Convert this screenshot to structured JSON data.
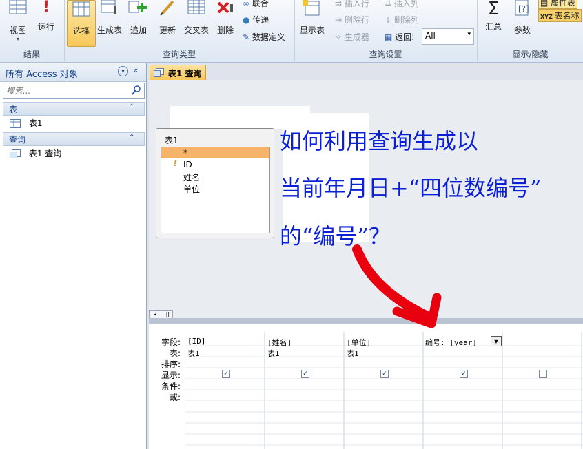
{
  "ribbon": {
    "buttons": {
      "view": "视图",
      "run": "运行",
      "select": "选择",
      "make_table": "生成表",
      "append": "追加",
      "update": "更新",
      "crosstab": "交叉表",
      "delete": "删除",
      "show_table": "显示表",
      "totals": "汇总",
      "parameters": "参数"
    },
    "small": {
      "union": "联合",
      "pass_through": "传递",
      "data_definition": "数据定义",
      "insert_rows": "插入行",
      "delete_rows": "删除行",
      "builder": "生成器",
      "insert_columns": "插入列",
      "delete_columns": "删除列",
      "return_label": "返回:",
      "return_value": "All",
      "property_sheet": "属性表",
      "table_names": "表名称"
    },
    "groups": {
      "results": "结果",
      "query_type": "查询类型",
      "query_setup": "查询设置",
      "show_hide": "显示/隐藏"
    }
  },
  "nav": {
    "title": "所有 Access 对象",
    "search_placeholder": "搜索...",
    "sections": [
      {
        "label": "表",
        "items": [
          "表1"
        ]
      },
      {
        "label": "查询",
        "items": [
          "表1 查询"
        ]
      }
    ]
  },
  "doc_tab": "表1 查询",
  "table_box": {
    "title": "表1",
    "fields": [
      "*",
      "ID",
      "姓名",
      "单位"
    ]
  },
  "annotation": {
    "line1": "如何利用查询生成以",
    "line2": "当前年月日+“四位数编号”",
    "line3": "的“编号”？"
  },
  "grid": {
    "row_labels": [
      "字段:",
      "表:",
      "排序:",
      "显示:",
      "条件:",
      "或:"
    ],
    "columns": [
      {
        "field": "[ID]",
        "table": "表1",
        "show": true
      },
      {
        "field": "[姓名]",
        "table": "表1",
        "show": true
      },
      {
        "field": "[单位]",
        "table": "表1",
        "show": true
      },
      {
        "field": "编号: [year]",
        "table": "",
        "show": true
      },
      {
        "field": "",
        "table": "",
        "show": false
      }
    ]
  },
  "colors": {
    "accent": "#f8c85a",
    "arrow": "#e8000e",
    "annotation": "#0a1fd6",
    "nav_text": "#15428b"
  }
}
